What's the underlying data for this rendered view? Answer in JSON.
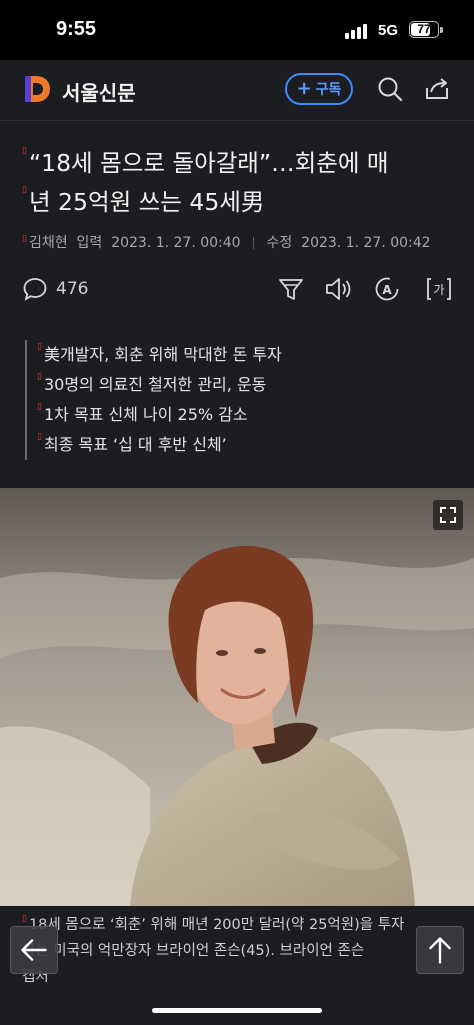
{
  "status": {
    "time": "9:55",
    "network": "5G",
    "battery": "77",
    "battery_level": 0.77
  },
  "header": {
    "brand": "서울신문",
    "subscribe_label": "구독",
    "icons": [
      "logo-icon",
      "search-icon",
      "share-icon"
    ]
  },
  "article": {
    "title_line1": "“18세 몸으로 돌아갈래”…회춘에 매",
    "title_line2": "년 25억원 쓰는 45세男",
    "author": "김채현",
    "input_label": "입력",
    "input_date": "2023. 1. 27. 00:40",
    "edit_label": "수정",
    "edit_date": "2023. 1. 27. 00:42",
    "comment_count": "476",
    "summary": [
      "美개발자, 회춘 위해 막대한 돈 투자",
      "30명의 의료진 철저한 관리, 운동",
      "1차 목표 신체 나이 25% 감소",
      "최종 목표 ‘십 대 후반 신체’"
    ],
    "caption_line1": "18세 몸으로 ‘회춘’ 위해 매년 200만 달러(약 25억원)을 투자",
    "caption_line2": "하는 미국의 억만장자 브라이언 존슨(45). 브라이언 존슨",
    "caption_line3": "캡처"
  },
  "colors": {
    "background": "#1c1d20",
    "accent": "#3d8bfd",
    "logo_orange": "#f07a2a",
    "logo_purple": "#5b3fd6"
  }
}
